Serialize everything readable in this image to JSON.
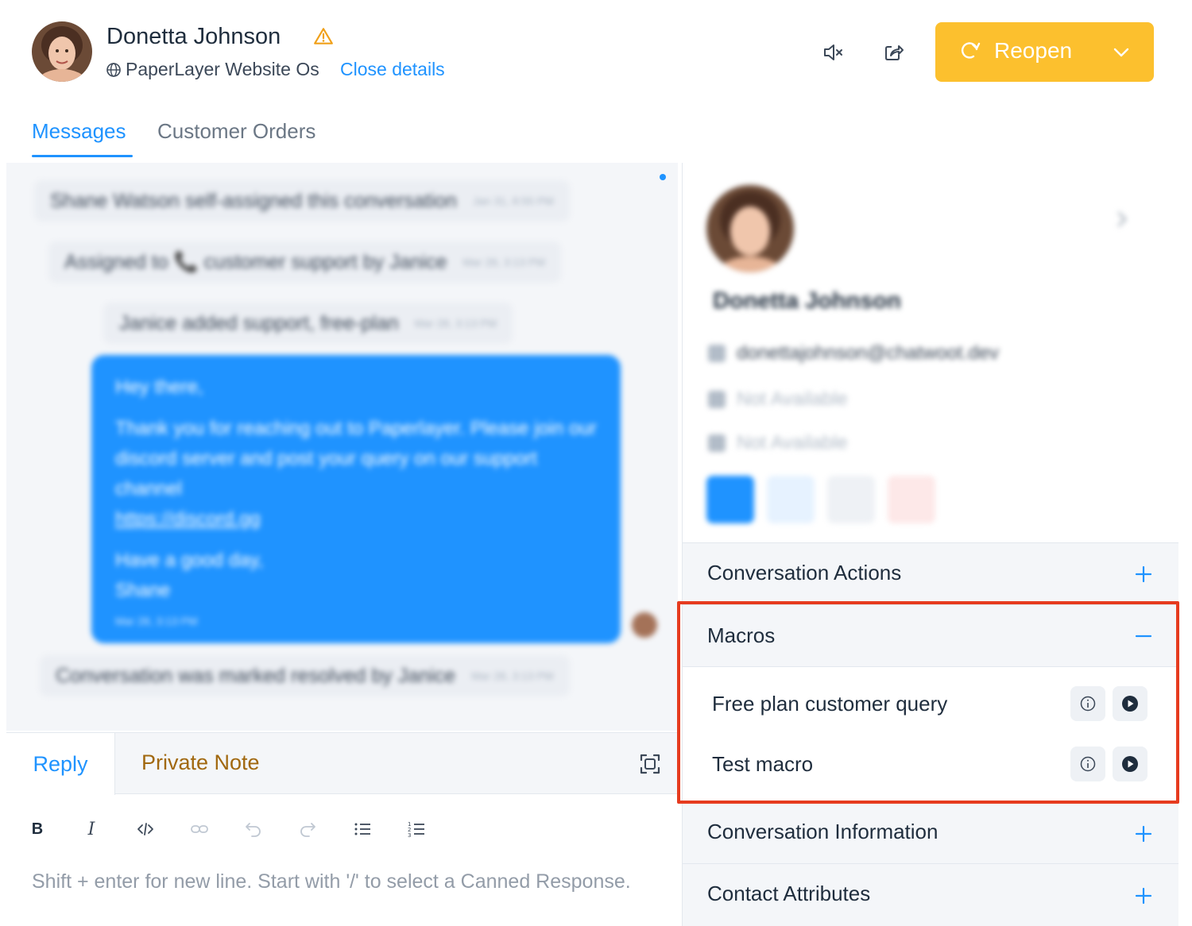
{
  "header": {
    "contact_name": "Donetta Johnson",
    "inbox_name": "PaperLayer Website Os",
    "close_details": "Close details",
    "reopen_label": "Reopen"
  },
  "tabs": [
    {
      "label": "Messages",
      "active": true
    },
    {
      "label": "Customer Orders",
      "active": false
    }
  ],
  "conversation": {
    "activities": [
      {
        "text": "Shane Watson self-assigned this conversation",
        "time": "Jan 31, 8:55 PM"
      },
      {
        "text": "Assigned to 📞 customer support by Janice",
        "time": "Mar 28, 3:13 PM"
      },
      {
        "text": "Janice added support, free-plan",
        "time": "Mar 28, 3:13 PM"
      }
    ],
    "message": {
      "greeting": "Hey there,",
      "body": "Thank you for reaching out to Paperlayer. Please join our discord server and post your query on our support channel",
      "link": "https://discord.gg",
      "closing_1": "Have a good day,",
      "closing_2": "Shane",
      "time": "Mar 28, 3:13 PM"
    },
    "resolved": {
      "text": "Conversation was marked resolved by Janice",
      "time": "Mar 28, 3:13 PM"
    }
  },
  "reply": {
    "reply_tab": "Reply",
    "note_tab": "Private Note",
    "placeholder": "Shift + enter for new line. Start with '/' to select a Canned Response.",
    "toolbar": [
      "bold-icon",
      "italic-icon",
      "code-icon",
      "link-icon",
      "undo-icon",
      "redo-icon",
      "bullet-list-icon",
      "numbered-list-icon"
    ]
  },
  "sidebar": {
    "name": "Donetta Johnson",
    "email": "donettajohnson@chatwoot.dev",
    "phone": "Not Available",
    "company": "Not Available",
    "sections": {
      "conversation_actions": "Conversation Actions",
      "macros": "Macros",
      "conversation_information": "Conversation Information",
      "contact_attributes": "Contact Attributes"
    },
    "macros": [
      {
        "name": "Free plan customer query"
      },
      {
        "name": "Test macro"
      }
    ]
  },
  "colors": {
    "accent": "#1f93ff",
    "reopen": "#fcc02e",
    "private_note": "#a1680f",
    "highlight": "#e63b1f"
  }
}
